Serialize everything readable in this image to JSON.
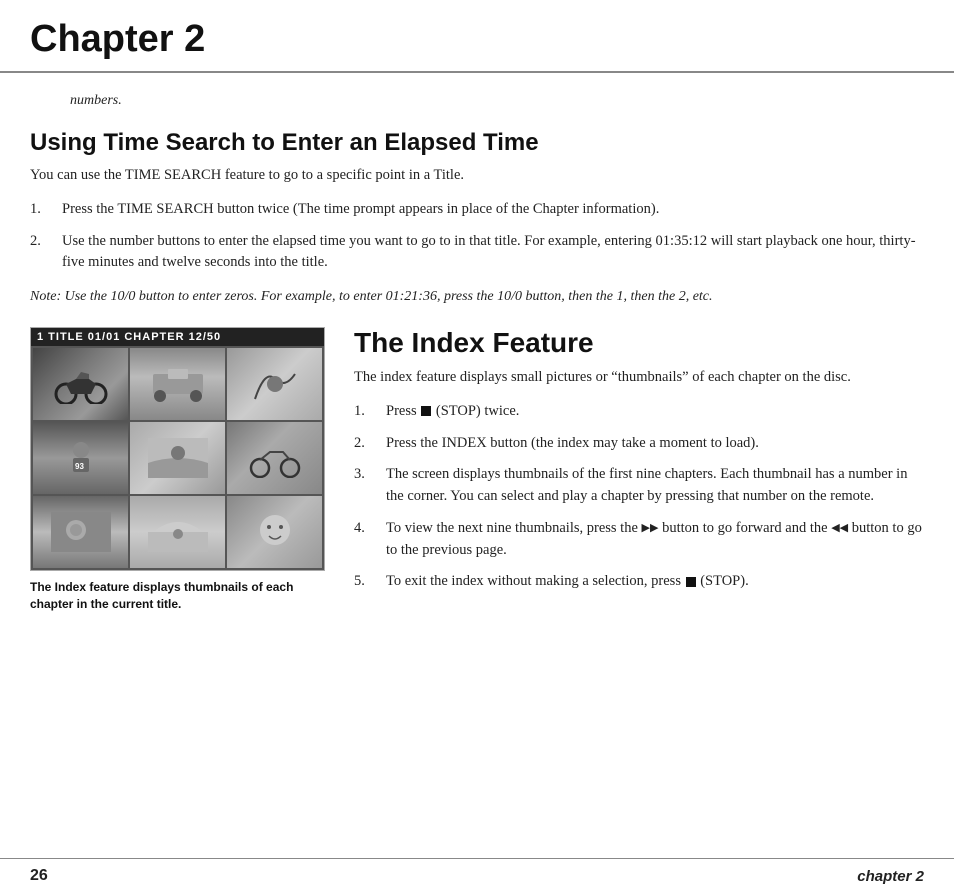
{
  "header": {
    "chapter_title": "Chapter 2"
  },
  "intro": {
    "italic_text": "numbers."
  },
  "time_search_section": {
    "heading": "Using Time Search to Enter an Elapsed Time",
    "intro": "You can use the TIME SEARCH feature to go to a specific point in a Title.",
    "steps": [
      {
        "num": "1.",
        "text": "Press the TIME SEARCH button twice (The time prompt appears in place of the Chapter information)."
      },
      {
        "num": "2.",
        "text": "Use the number buttons to enter the elapsed time you want to go to in that title. For example, entering 01:35:12 will start playback one hour, thirty-five minutes and twelve seconds into the title."
      }
    ],
    "note": "Note: Use the 10/0 button to enter zeros. For example, to enter 01:21:36, press the 10/0 button, then the 1, then the 2, etc."
  },
  "thumbnail_display": {
    "header_text": "1  TITLE  01/01  CHAPTER  12/50",
    "caption": "The Index feature displays thumbnails of each chapter in the current title."
  },
  "index_section": {
    "heading": "The Index Feature",
    "intro": "The index feature displays small pictures or “thumbnails” of each chapter on the disc.",
    "steps": [
      {
        "num": "1.",
        "text_before": "Press ",
        "icon": "stop",
        "text_after": " (STOP) twice."
      },
      {
        "num": "2.",
        "text": "Press the INDEX button (the index may take a moment to load)."
      },
      {
        "num": "3.",
        "text": "The screen displays thumbnails of the first nine chapters. Each thumbnail has a number in the corner. You can select and play a chapter by pressing that number on the remote."
      },
      {
        "num": "4.",
        "text_before": "To view the next nine thumbnails, press the ",
        "icon_ff": "▶▶",
        "text_mid": " button to go forward and the ",
        "icon_rew": "◄◄",
        "text_after": " button to go to the previous page."
      },
      {
        "num": "5.",
        "text_before": "To exit the index without making a selection, press ",
        "icon": "stop",
        "text_after": " (STOP)."
      }
    ]
  },
  "footer": {
    "page_number": "26",
    "chapter_label": "chapter 2"
  }
}
